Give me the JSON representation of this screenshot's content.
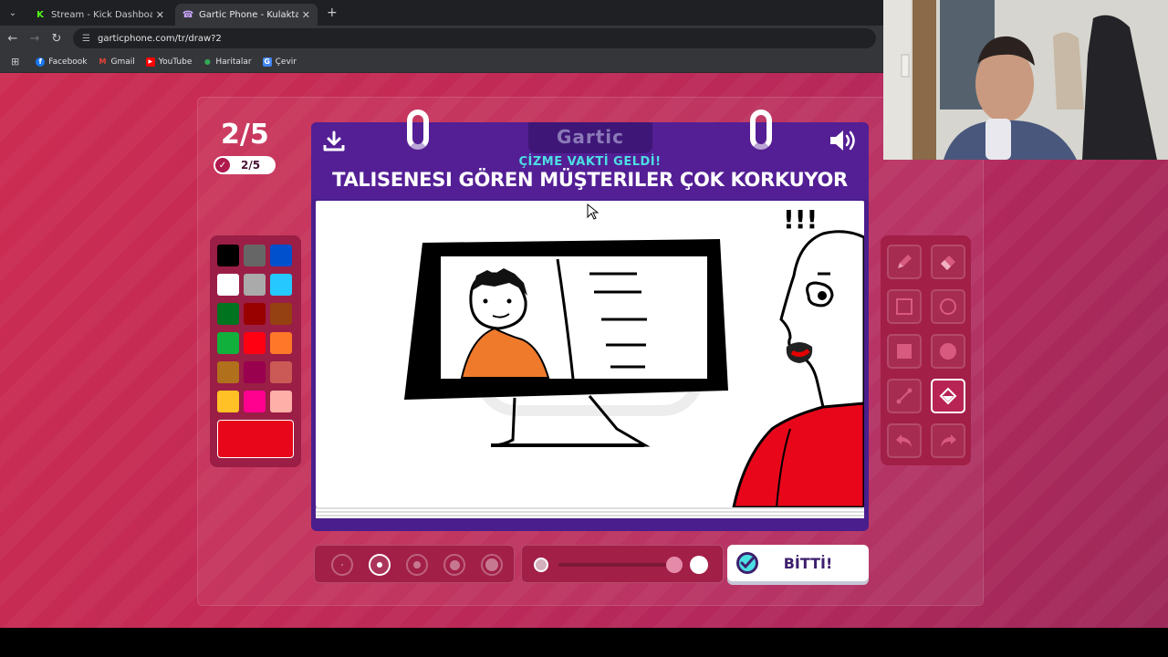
{
  "browser": {
    "tabs": [
      {
        "title": "Stream - Kick Dashboard",
        "icon": "kick-icon",
        "active": false
      },
      {
        "title": "Gartic Phone - Kulaktan Kulağa",
        "icon": "gartic-icon",
        "active": true
      }
    ],
    "url": "garticphone.com/tr/draw?2",
    "bookmarks": [
      {
        "label": "Facebook",
        "icon": "facebook-icon"
      },
      {
        "label": "Gmail",
        "icon": "gmail-icon"
      },
      {
        "label": "YouTube",
        "icon": "youtube-icon"
      },
      {
        "label": "Haritalar",
        "icon": "maps-icon"
      },
      {
        "label": "Çevir",
        "icon": "translate-icon"
      }
    ]
  },
  "game": {
    "round": "2/5",
    "done_count": "2/5",
    "logo": "Gartic",
    "subtitle": "ÇİZME VAKTİ GELDİ!",
    "prompt": "TALISENESI GÖREN MÜŞTERILER ÇOK KORKUYOR",
    "canvas_annotation": "!!!",
    "done_button": "BİTTİ!",
    "palette": [
      "#000000",
      "#666666",
      "#0050cd",
      "#ffffff",
      "#aaaaaa",
      "#26c9ff",
      "#017420",
      "#990000",
      "#964112",
      "#11b03c",
      "#ff0013",
      "#ff7829",
      "#b0701c",
      "#99004e",
      "#cb5a57",
      "#ffc126",
      "#ff008f",
      "#feafa8"
    ],
    "current_color": "#e8071a",
    "tools": [
      {
        "name": "pen-tool",
        "selected": false
      },
      {
        "name": "eraser-tool",
        "selected": false
      },
      {
        "name": "rectangle-outline-tool",
        "selected": false
      },
      {
        "name": "ellipse-outline-tool",
        "selected": false
      },
      {
        "name": "rectangle-fill-tool",
        "selected": false
      },
      {
        "name": "ellipse-fill-tool",
        "selected": false
      },
      {
        "name": "line-tool",
        "selected": false
      },
      {
        "name": "fill-bucket-tool",
        "selected": true
      },
      {
        "name": "undo-tool",
        "selected": false
      },
      {
        "name": "redo-tool",
        "selected": false
      }
    ],
    "brush_sizes_selected_index": 1,
    "opacity_level": 1
  }
}
